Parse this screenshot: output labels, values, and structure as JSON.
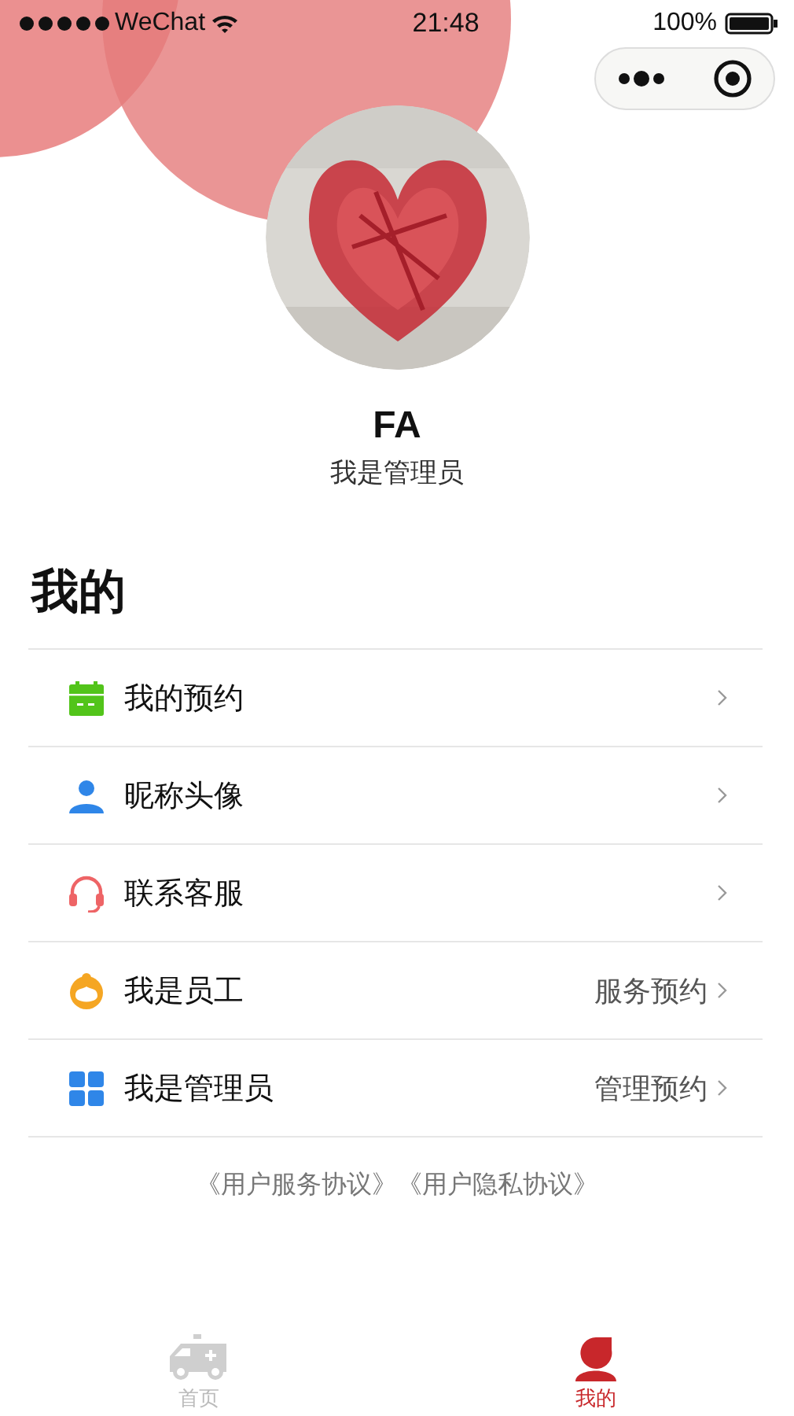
{
  "status_bar": {
    "carrier": "WeChat",
    "time": "21:48",
    "battery": "100%"
  },
  "profile": {
    "name": "FA",
    "role": "我是管理员"
  },
  "section_title": "我的",
  "menu": [
    {
      "label": "我的预约"
    },
    {
      "label": "昵称头像"
    },
    {
      "label": "联系客服"
    },
    {
      "label": "我是员工",
      "value": "服务预约"
    },
    {
      "label": "我是管理员",
      "value": "管理预约"
    }
  ],
  "agreements": [
    "《用户服务协议》",
    "《用户隐私协议》"
  ],
  "tabs": [
    {
      "label": "首页",
      "selected": false
    },
    {
      "label": "我的",
      "selected": true
    }
  ]
}
